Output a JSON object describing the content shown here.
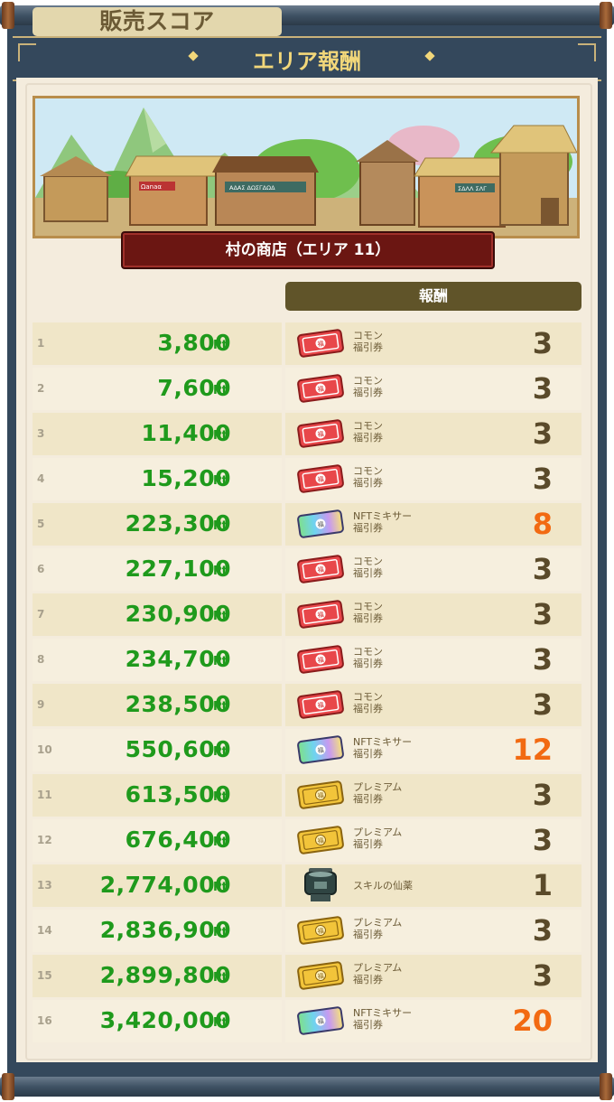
{
  "title": "エリア報酬",
  "area_name": "村の商店（エリア 11）",
  "banner_signs": [
    "Ωanaα",
    "ΑΔΑΣ ΔΩΣΓΔΩΔ",
    "ΣΔΛΛ ΣΛΓ"
  ],
  "headers": {
    "score": "販売スコア",
    "reward": "報酬"
  },
  "pt_unit": "Pt",
  "colors": {
    "score_green": "#1f9a1c",
    "highlight_orange": "#f26a12",
    "header_dark": "#605429"
  },
  "rows": [
    {
      "rank": "1",
      "score": "3,800",
      "reward_type": "common-ticket",
      "reward_line1": "コモン",
      "reward_line2": "福引券",
      "qty": "3",
      "highlight": false
    },
    {
      "rank": "2",
      "score": "7,600",
      "reward_type": "common-ticket",
      "reward_line1": "コモン",
      "reward_line2": "福引券",
      "qty": "3",
      "highlight": false
    },
    {
      "rank": "3",
      "score": "11,400",
      "reward_type": "common-ticket",
      "reward_line1": "コモン",
      "reward_line2": "福引券",
      "qty": "3",
      "highlight": false
    },
    {
      "rank": "4",
      "score": "15,200",
      "reward_type": "common-ticket",
      "reward_line1": "コモン",
      "reward_line2": "福引券",
      "qty": "3",
      "highlight": false
    },
    {
      "rank": "5",
      "score": "223,300",
      "reward_type": "nft-ticket",
      "reward_line1": "NFTミキサー",
      "reward_line2": "福引券",
      "qty": "8",
      "highlight": true
    },
    {
      "rank": "6",
      "score": "227,100",
      "reward_type": "common-ticket",
      "reward_line1": "コモン",
      "reward_line2": "福引券",
      "qty": "3",
      "highlight": false
    },
    {
      "rank": "7",
      "score": "230,900",
      "reward_type": "common-ticket",
      "reward_line1": "コモン",
      "reward_line2": "福引券",
      "qty": "3",
      "highlight": false
    },
    {
      "rank": "8",
      "score": "234,700",
      "reward_type": "common-ticket",
      "reward_line1": "コモン",
      "reward_line2": "福引券",
      "qty": "3",
      "highlight": false
    },
    {
      "rank": "9",
      "score": "238,500",
      "reward_type": "common-ticket",
      "reward_line1": "コモン",
      "reward_line2": "福引券",
      "qty": "3",
      "highlight": false
    },
    {
      "rank": "10",
      "score": "550,600",
      "reward_type": "nft-ticket",
      "reward_line1": "NFTミキサー",
      "reward_line2": "福引券",
      "qty": "12",
      "highlight": true
    },
    {
      "rank": "11",
      "score": "613,500",
      "reward_type": "premium-ticket",
      "reward_line1": "プレミアム",
      "reward_line2": "福引券",
      "qty": "3",
      "highlight": false
    },
    {
      "rank": "12",
      "score": "676,400",
      "reward_type": "premium-ticket",
      "reward_line1": "プレミアム",
      "reward_line2": "福引券",
      "qty": "3",
      "highlight": false
    },
    {
      "rank": "13",
      "score": "2,774,000",
      "reward_type": "skill-elixir",
      "reward_line1": "スキルの仙薬",
      "reward_line2": "",
      "qty": "1",
      "highlight": false
    },
    {
      "rank": "14",
      "score": "2,836,900",
      "reward_type": "premium-ticket",
      "reward_line1": "プレミアム",
      "reward_line2": "福引券",
      "qty": "3",
      "highlight": false
    },
    {
      "rank": "15",
      "score": "2,899,800",
      "reward_type": "premium-ticket",
      "reward_line1": "プレミアム",
      "reward_line2": "福引券",
      "qty": "3",
      "highlight": false
    },
    {
      "rank": "16",
      "score": "3,420,000",
      "reward_type": "nft-ticket",
      "reward_line1": "NFTミキサー",
      "reward_line2": "福引券",
      "qty": "20",
      "highlight": true
    }
  ]
}
